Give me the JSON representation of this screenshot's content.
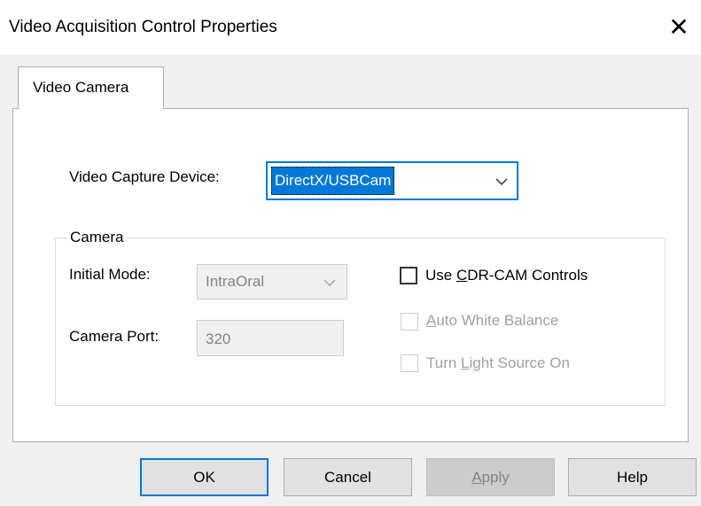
{
  "window": {
    "title": "Video Acquisition Control Properties",
    "close_glyph": "✕"
  },
  "tabs": [
    {
      "label": "Video Camera",
      "selected": true
    }
  ],
  "capture_device": {
    "label": "Video Capture Device:",
    "value": "DirectX/USBCam",
    "icon": "chevron-down-icon"
  },
  "camera_group": {
    "label": "Camera",
    "initial_mode": {
      "label": "Initial Mode:",
      "value": "IntraOral",
      "enabled": false
    },
    "camera_port": {
      "label": "Camera Port:",
      "value": "320",
      "enabled": false
    },
    "use_cdr_cam": {
      "pre": "Use ",
      "accel": "C",
      "post": "DR-CAM Controls",
      "checked": false,
      "enabled": true
    },
    "auto_white_balance": {
      "pre": "",
      "accel": "A",
      "post": "uto White Balance",
      "checked": false,
      "enabled": false
    },
    "turn_light": {
      "pre": "Turn ",
      "accel": "L",
      "post": "ight Source On",
      "checked": false,
      "enabled": false
    }
  },
  "buttons": {
    "ok": "OK",
    "cancel": "Cancel",
    "apply_accel": "A",
    "apply_rest": "pply",
    "help": "Help"
  },
  "colors": {
    "accent": "#0078d7",
    "disabled_text": "#a0a0a0"
  }
}
